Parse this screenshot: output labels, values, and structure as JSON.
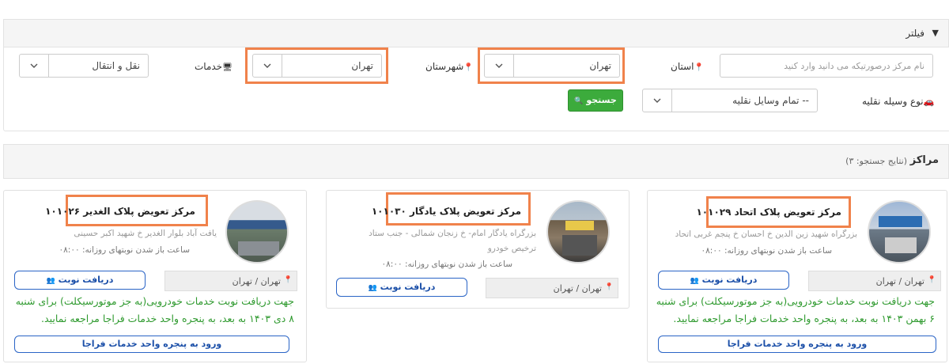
{
  "filter": {
    "title": "فیلتر",
    "name_placeholder": "نام مرکز درصورتیکه می دانید وارد کنید",
    "province_label": "استان",
    "province_value": "تهران",
    "city_label": "شهرستان",
    "city_value": "تهران",
    "services_label": "خدمات",
    "services_value": "نقل و انتقال",
    "vehicle_label": "نوع وسیله نقلیه",
    "vehicle_value": "-- تمام وسایل نقلیه",
    "search_label": "جستجو"
  },
  "results": {
    "title": "مراکز",
    "count_text": "(نتایج جستجو: ۳)"
  },
  "cards": [
    {
      "title": "مرکز تعویض پلاک اتحاد ۱۰۱۰۲۹",
      "address": "بزرگراه شهید زین الدین خ احسان خ پنجم غربی اتحاد",
      "address2": "",
      "hours": "ساعت باز شدن نوبتهای روزانه: ۰۸:۰۰",
      "location": "تهران / تهران",
      "appointment_label": "دریافت نوبت",
      "notice": "جهت دریافت نوبت خدمات خودرویی(به جز موتورسیکلت) برای شنبه ۶ بهمن ۱۴۰۳ به بعد، به پنجره واحد خدمات فراجا مراجعه نمایید.",
      "portal_label": "ورود به پنجره واحد خدمات فراجا"
    },
    {
      "title": "مرکز تعویض پلاک یادگار ۱۰۱۰۳۰",
      "address": "بزرگراه یادگار امام- خ زنجان شمالی - جنب ستاد",
      "address2": "ترخیص خودرو",
      "hours": "ساعت باز شدن نوبتهای روزانه: ۰۸:۰۰",
      "location": "تهران / تهران",
      "appointment_label": "دریافت نوبت"
    },
    {
      "title": "مرکز تعویض پلاک الغدیر ۱۰۱۰۲۶",
      "address": "یافت آباد بلوار الغدیر خ شهید اکبر حسینی",
      "address2": "",
      "hours": "ساعت باز شدن نوبتهای روزانه: ۰۸:۰۰",
      "location": "تهران / تهران",
      "appointment_label": "دریافت نوبت",
      "notice": "جهت دریافت نوبت خدمات خودرویی(به جز موتورسیکلت) برای شنبه ۸ دی ۱۴۰۳ به بعد، به پنجره واحد خدمات فراجا مراجعه نمایید.",
      "portal_label": "ورود به پنجره واحد خدمات فراجا"
    }
  ]
}
